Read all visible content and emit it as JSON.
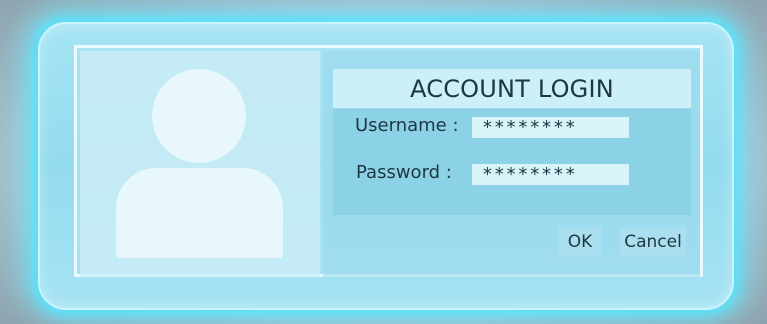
{
  "dialog": {
    "title": "ACCOUNT LOGIN",
    "username": {
      "label": "Username :",
      "value": "********"
    },
    "password": {
      "label": "Password :",
      "value": "********"
    },
    "buttons": {
      "ok": "OK",
      "cancel": "Cancel"
    }
  },
  "colors": {
    "glow": "#5ee6fb",
    "panel": "#9ddff0",
    "frame_border": "#e9fbff",
    "text": "#1f3640"
  },
  "icons": {
    "avatar": "user-silhouette-icon"
  }
}
